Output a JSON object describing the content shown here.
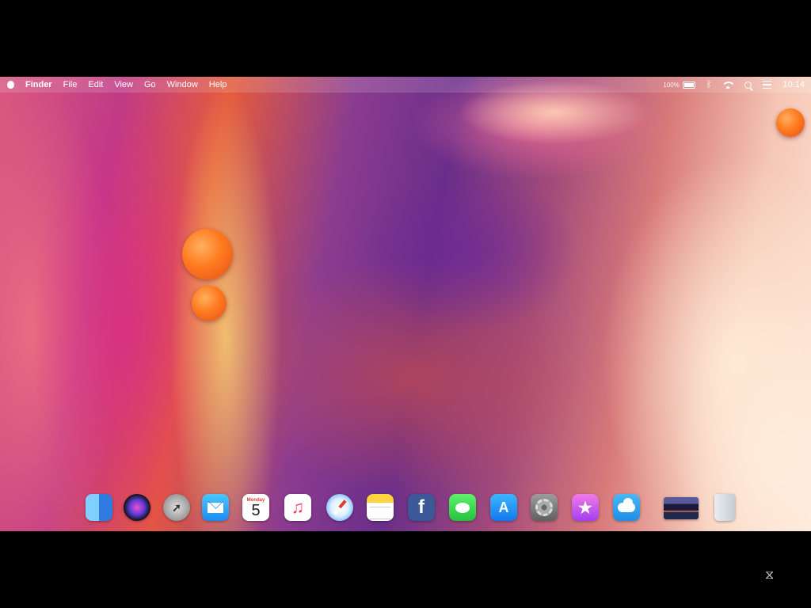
{
  "menubar": {
    "app_name": "Finder",
    "menus": [
      "File",
      "Edit",
      "View",
      "Go",
      "Window",
      "Help"
    ],
    "battery_percent": "100%",
    "clock": "10:14"
  },
  "dock": {
    "calendar_month": "Monday",
    "calendar_day": "5",
    "apps": [
      "Finder",
      "Siri",
      "Launchpad",
      "Mail",
      "Calendar",
      "Music",
      "Safari",
      "Notes",
      "Facebook",
      "Messages",
      "App Store",
      "System Preferences",
      "iTunes Store",
      "Weather",
      "Photo",
      "Trash"
    ]
  }
}
